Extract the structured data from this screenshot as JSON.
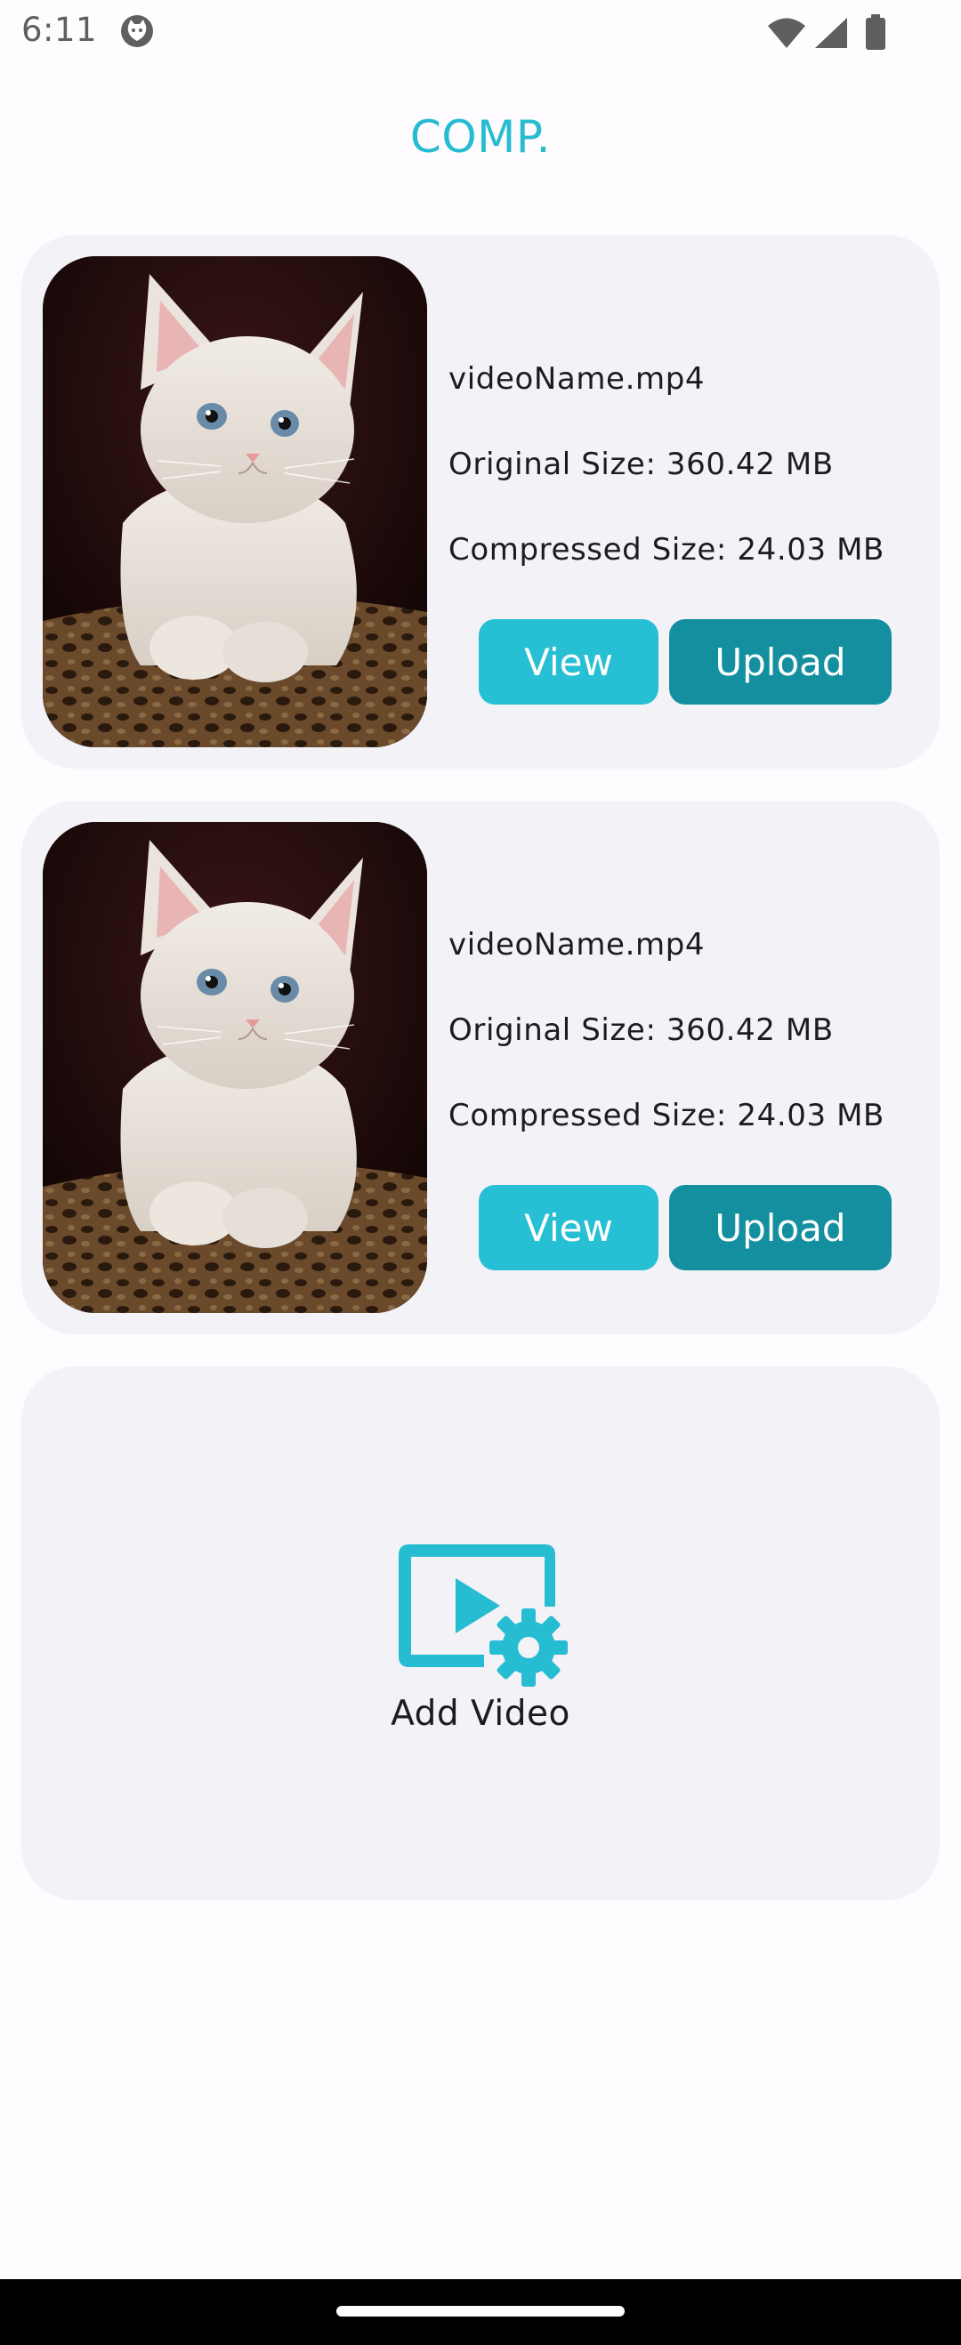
{
  "status_bar": {
    "time": "6:11",
    "icons": [
      "cat-notification-icon",
      "wifi-icon",
      "signal-icon",
      "battery-icon"
    ]
  },
  "app": {
    "title": "COMP.",
    "accent_color": "#26bcd1",
    "upload_color": "#138f9f"
  },
  "videos": [
    {
      "name": "videoName.mp4",
      "original_size": "Original Size: 360.42 MB",
      "compressed_size": "Compressed Size: 24.03 MB",
      "view_label": "View",
      "upload_label": "Upload",
      "thumbnail": "white-kitten-photo"
    },
    {
      "name": "videoName.mp4",
      "original_size": "Original Size: 360.42 MB",
      "compressed_size": "Compressed Size: 24.03 MB",
      "view_label": "View",
      "upload_label": "Upload",
      "thumbnail": "white-kitten-photo"
    }
  ],
  "add_video": {
    "label": "Add Video",
    "icon": "video-settings-icon"
  }
}
